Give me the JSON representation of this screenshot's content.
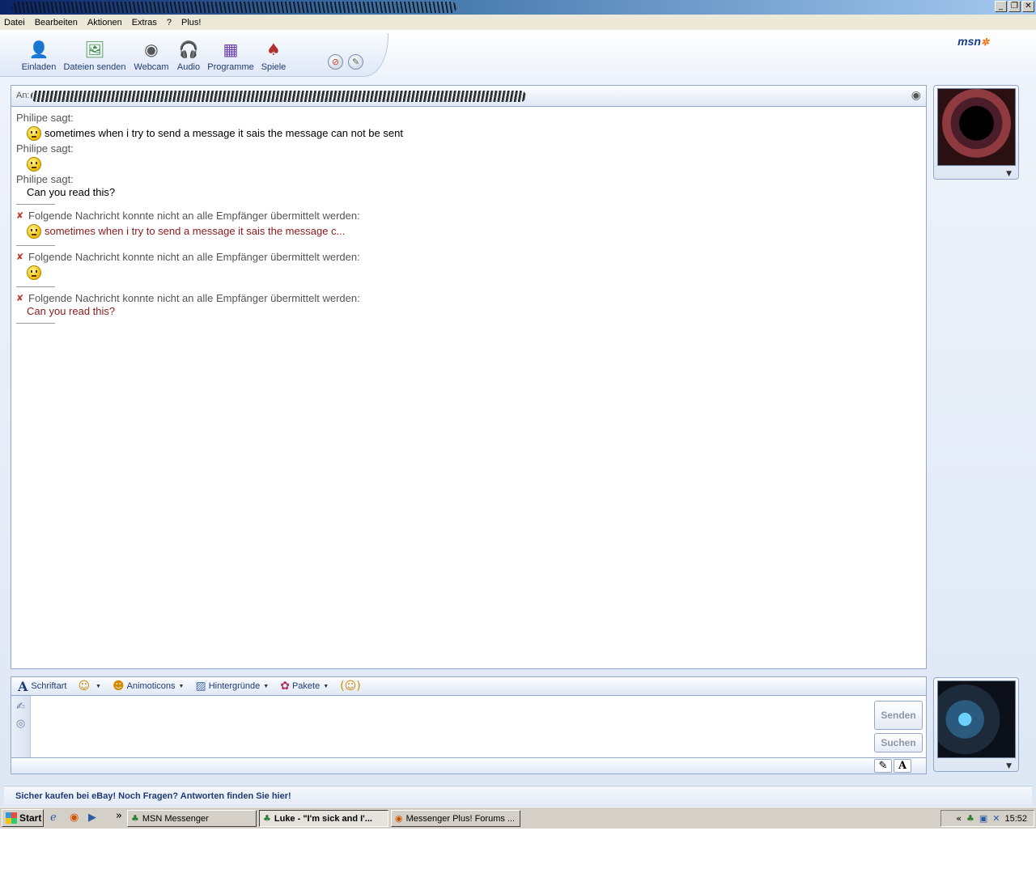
{
  "menu": [
    "Datei",
    "Bearbeiten",
    "Aktionen",
    "Extras",
    "?",
    "Plus!"
  ],
  "toolbar": {
    "buttons": [
      {
        "label": "Einladen",
        "icon": "invite-icon"
      },
      {
        "label": "Dateien senden",
        "icon": "send-files-icon"
      },
      {
        "label": "Webcam",
        "icon": "webcam-icon"
      },
      {
        "label": "Audio",
        "icon": "audio-icon"
      },
      {
        "label": "Programme",
        "icon": "programs-icon"
      },
      {
        "label": "Spiele",
        "icon": "games-icon"
      }
    ],
    "logo": "msn"
  },
  "to_bar": {
    "label": "An:"
  },
  "history": {
    "messages": [
      {
        "sender": "Philipe sagt:",
        "emoticon": true,
        "text": "sometimes when i try to send a message it sais the message can not be sent"
      },
      {
        "sender": "Philipe sagt:",
        "emoticon": true,
        "text": ""
      },
      {
        "sender": "Philipe sagt:",
        "emoticon": false,
        "text": "Can you read this?"
      }
    ],
    "failures": [
      {
        "notice": "Folgende Nachricht konnte nicht an alle Empfänger übermittelt werden:",
        "emoticon": true,
        "text": "sometimes when i try to send a message it sais the message c..."
      },
      {
        "notice": "Folgende Nachricht konnte nicht an alle Empfänger übermittelt werden:",
        "emoticon": true,
        "text": ""
      },
      {
        "notice": "Folgende Nachricht konnte nicht an alle Empfänger übermittelt werden:",
        "emoticon": false,
        "text": "Can you read this?"
      }
    ]
  },
  "format_bar": {
    "font": "Schriftart",
    "animoticons": "Animoticons",
    "backgrounds": "Hintergründe",
    "packages": "Pakete"
  },
  "input": {
    "value": "",
    "send": "Senden",
    "search": "Suchen"
  },
  "ad": "Sicher kaufen bei eBay! Noch Fragen? Antworten finden Sie hier!",
  "taskbar": {
    "start": "Start",
    "tasks": [
      {
        "label": "MSN Messenger",
        "active": false
      },
      {
        "label": "Luke - \"I'm sick and I'...",
        "active": true
      },
      {
        "label": "Messenger Plus! Forums ...",
        "active": false
      }
    ],
    "clock": "15:52"
  },
  "colors": {
    "accent": "#1f3b75",
    "error_text": "#8b1a1a",
    "border": "#93a7c8"
  }
}
